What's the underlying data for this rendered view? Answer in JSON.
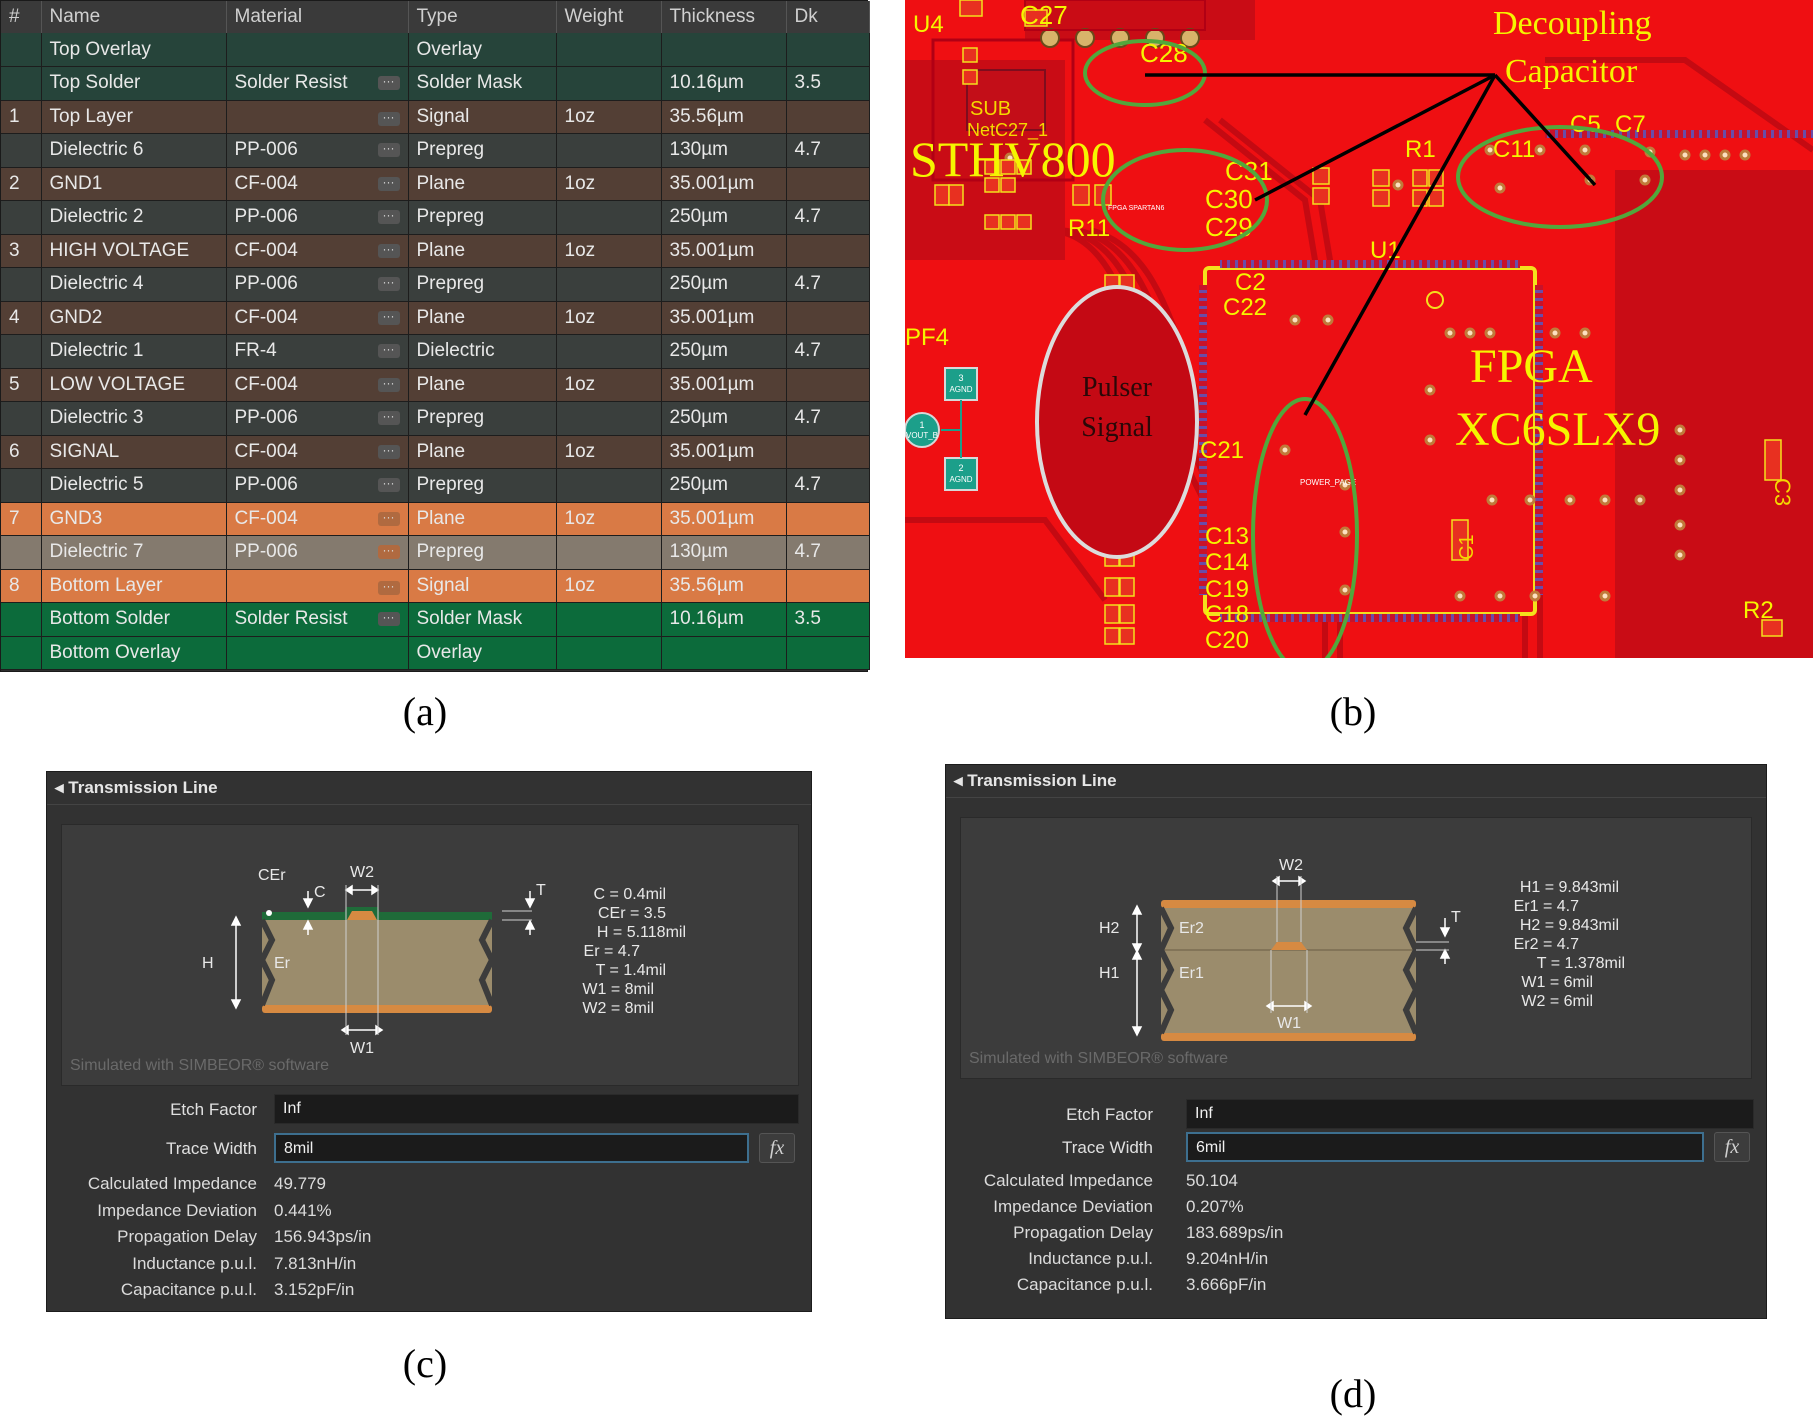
{
  "captions": {
    "a": "(a)",
    "b": "(b)",
    "c": "(c)",
    "d": "(d)"
  },
  "stack": {
    "headers": [
      "#",
      "Name",
      "Material",
      "Type",
      "Weight",
      "Thickness",
      "Dk"
    ],
    "rows": [
      {
        "num": "",
        "name": "Top Overlay",
        "material": "",
        "type": "Overlay",
        "weight": "",
        "thickness": "",
        "dk": "",
        "color": "#26443a",
        "menu": false
      },
      {
        "num": "",
        "name": "Top Solder",
        "material": "Solder Resist",
        "type": "Solder Mask",
        "weight": "",
        "thickness": "10.16µm",
        "dk": "3.5",
        "color": "#26443a",
        "menu": true
      },
      {
        "num": "1",
        "name": "Top Layer",
        "material": "",
        "type": "Signal",
        "weight": "1oz",
        "thickness": "35.56µm",
        "dk": "",
        "color": "#533f35",
        "menu": true
      },
      {
        "num": "",
        "name": "Dielectric 6",
        "material": "PP-006",
        "type": "Prepreg",
        "weight": "",
        "thickness": "130µm",
        "dk": "4.7",
        "color": "#3a3f3d",
        "menu": true
      },
      {
        "num": "2",
        "name": "GND1",
        "material": "CF-004",
        "type": "Plane",
        "weight": "1oz",
        "thickness": "35.001µm",
        "dk": "",
        "color": "#533f35",
        "menu": true
      },
      {
        "num": "",
        "name": "Dielectric 2",
        "material": "PP-006",
        "type": "Prepreg",
        "weight": "",
        "thickness": "250µm",
        "dk": "4.7",
        "color": "#3a3f3d",
        "menu": true
      },
      {
        "num": "3",
        "name": "HIGH VOLTAGE",
        "material": "CF-004",
        "type": "Plane",
        "weight": "1oz",
        "thickness": "35.001µm",
        "dk": "",
        "color": "#533f35",
        "menu": true
      },
      {
        "num": "",
        "name": "Dielectric 4",
        "material": "PP-006",
        "type": "Prepreg",
        "weight": "",
        "thickness": "250µm",
        "dk": "4.7",
        "color": "#3a3f3d",
        "menu": true
      },
      {
        "num": "4",
        "name": "GND2",
        "material": "CF-004",
        "type": "Plane",
        "weight": "1oz",
        "thickness": "35.001µm",
        "dk": "",
        "color": "#533f35",
        "menu": true
      },
      {
        "num": "",
        "name": "Dielectric 1",
        "material": "FR-4",
        "type": "Dielectric",
        "weight": "",
        "thickness": "250µm",
        "dk": "4.7",
        "color": "#3a3f3d",
        "menu": true
      },
      {
        "num": "5",
        "name": "LOW VOLTAGE",
        "material": "CF-004",
        "type": "Plane",
        "weight": "1oz",
        "thickness": "35.001µm",
        "dk": "",
        "color": "#533f35",
        "menu": true
      },
      {
        "num": "",
        "name": "Dielectric 3",
        "material": "PP-006",
        "type": "Prepreg",
        "weight": "",
        "thickness": "250µm",
        "dk": "4.7",
        "color": "#3a3f3d",
        "menu": true
      },
      {
        "num": "6",
        "name": "SIGNAL",
        "material": "CF-004",
        "type": "Plane",
        "weight": "1oz",
        "thickness": "35.001µm",
        "dk": "",
        "color": "#533f35",
        "menu": true
      },
      {
        "num": "",
        "name": "Dielectric 5",
        "material": "PP-006",
        "type": "Prepreg",
        "weight": "",
        "thickness": "250µm",
        "dk": "4.7",
        "color": "#3a3f3d",
        "menu": true
      },
      {
        "num": "7",
        "name": "GND3",
        "material": "CF-004",
        "type": "Plane",
        "weight": "1oz",
        "thickness": "35.001µm",
        "dk": "",
        "color": "#d97a45",
        "menu": true,
        "highlight": true
      },
      {
        "num": "",
        "name": "Dielectric 7",
        "material": "PP-006",
        "type": "Prepreg",
        "weight": "",
        "thickness": "130µm",
        "dk": "4.7",
        "color": "#847a6e",
        "menu": true,
        "highlight": true
      },
      {
        "num": "8",
        "name": "Bottom Layer",
        "material": "",
        "type": "Signal",
        "weight": "1oz",
        "thickness": "35.56µm",
        "dk": "",
        "color": "#d97a45",
        "menu": true,
        "highlight": true
      },
      {
        "num": "",
        "name": "Bottom Solder",
        "material": "Solder Resist",
        "type": "Solder Mask",
        "weight": "",
        "thickness": "10.16µm",
        "dk": "3.5",
        "color": "#0c6b3b",
        "menu": true
      },
      {
        "num": "",
        "name": "Bottom Overlay",
        "material": "",
        "type": "Overlay",
        "weight": "",
        "thickness": "",
        "dk": "",
        "color": "#0c6b3b",
        "menu": false
      }
    ]
  },
  "pcb": {
    "board_color": "#f00c0c",
    "annotation_color": "#ffff00",
    "labels": {
      "u4": "U4",
      "c27": "C27",
      "c28": "C28",
      "decoupling": "Decoupling",
      "capacitor": "Capacitor",
      "sub": "SUB",
      "netc27": "NetC27_1",
      "sthv": "STHV800",
      "r1": "R1",
      "c5": "C5",
      "c7": "C7",
      "c11": "C11",
      "c31": "C31",
      "c30": "C30",
      "c29": "C29",
      "r11": "R11",
      "u1": "U1",
      "fpga_spartan": "FPGA SPARTAN6",
      "c2": "C2",
      "c22": "C22",
      "pf4": "PF4",
      "pulser": "Pulser",
      "signal": "Signal",
      "fpga": "FPGA",
      "fpga_part": "XC6SLX9",
      "c21": "C21",
      "power_page": "POWER_PAGE",
      "c3": "C3",
      "c13": "C13",
      "c14": "C14",
      "c19": "C19",
      "c18": "C18",
      "c20": "C20",
      "c1": "C1",
      "r2": "R2",
      "pad1": "1",
      "pad1b": "VOUT_B",
      "pad3": "3",
      "pad3b": "AGND",
      "pad2": "2",
      "pad2b": "AGND"
    }
  },
  "dialog_c": {
    "title": "Transmission Line",
    "diagram": {
      "labels": {
        "cer": "CEr",
        "c": "C",
        "w2": "W2",
        "t": "T",
        "h": "H",
        "er": "Er",
        "w1": "W1"
      },
      "params": [
        "C = 0.4mil",
        "CEr = 3.5",
        "H = 5.118mil",
        "Er = 4.7",
        "T = 1.4mil",
        "W1 = 8mil",
        "W2 = 8mil"
      ],
      "sim_text": "Simulated with SIMBEOR® software"
    },
    "etch_factor_label": "Etch Factor",
    "etch_factor": "Inf",
    "trace_width_label": "Trace Width",
    "trace_width": "8mil",
    "fx": "fx",
    "results": [
      {
        "label": "Calculated Impedance",
        "value": "49.779"
      },
      {
        "label": "Impedance Deviation",
        "value": "0.441%"
      },
      {
        "label": "Propagation Delay",
        "value": "156.943ps/in"
      },
      {
        "label": "Inductance p.u.l.",
        "value": "7.813nH/in"
      },
      {
        "label": "Capacitance p.u.l.",
        "value": "3.152pF/in"
      }
    ]
  },
  "dialog_d": {
    "title": "Transmission Line",
    "diagram": {
      "labels": {
        "w2": "W2",
        "t": "T",
        "h2": "H2",
        "h1": "H1",
        "er2": "Er2",
        "er1": "Er1",
        "w1": "W1"
      },
      "params": [
        "H1 = 9.843mil",
        "Er1 = 4.7",
        "H2 = 9.843mil",
        "Er2 = 4.7",
        "T = 1.378mil",
        "W1 = 6mil",
        "W2 = 6mil"
      ],
      "sim_text": "Simulated with SIMBEOR® software"
    },
    "etch_factor_label": "Etch Factor",
    "etch_factor": "Inf",
    "trace_width_label": "Trace Width",
    "trace_width": "6mil",
    "fx": "fx",
    "results": [
      {
        "label": "Calculated Impedance",
        "value": "50.104"
      },
      {
        "label": "Impedance Deviation",
        "value": "0.207%"
      },
      {
        "label": "Propagation Delay",
        "value": "183.689ps/in"
      },
      {
        "label": "Inductance p.u.l.",
        "value": "9.204nH/in"
      },
      {
        "label": "Capacitance p.u.l.",
        "value": "3.666pF/in"
      }
    ]
  }
}
